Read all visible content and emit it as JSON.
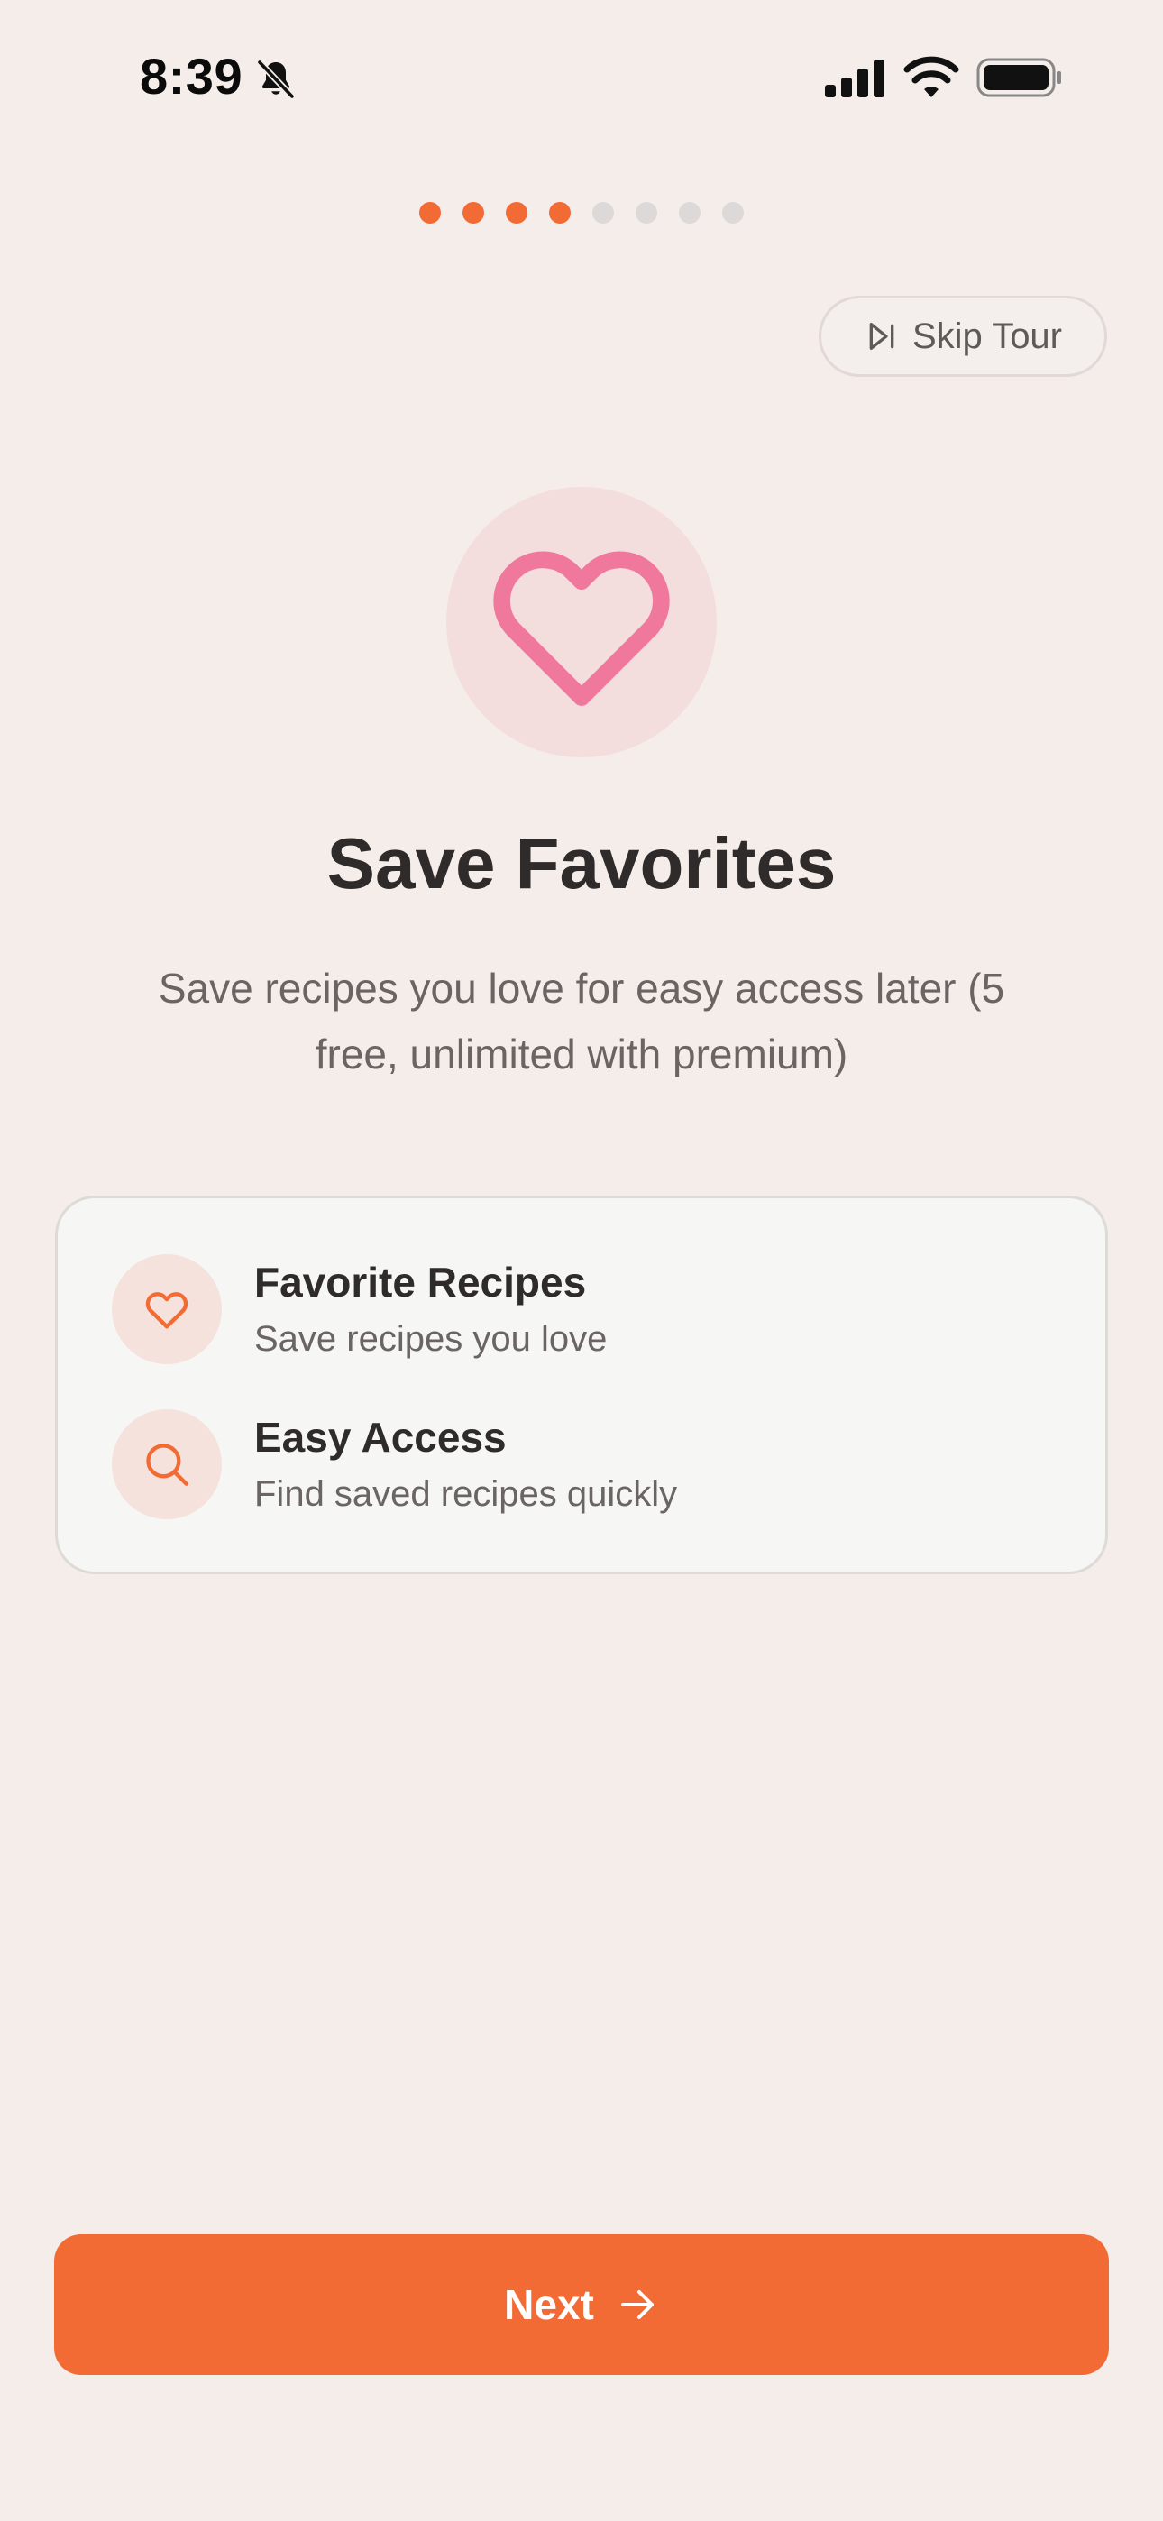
{
  "status_bar": {
    "time": "8:39",
    "icons": [
      "bell-slash-icon",
      "cellular-signal-icon",
      "wifi-icon",
      "battery-icon"
    ]
  },
  "onboarding": {
    "total_steps": 8,
    "current_step": 4
  },
  "skip_tour": {
    "label": "Skip Tour",
    "icon": "skip-forward-icon"
  },
  "hero": {
    "icon": "heart-icon",
    "icon_color": "#F0789C",
    "background": "#F4DEDD"
  },
  "title": "Save Favorites",
  "subtitle": "Save recipes you love for easy access later (5 free, unlimited with premium)",
  "features": [
    {
      "icon": "heart-icon",
      "title": "Favorite Recipes",
      "description": "Save recipes you love"
    },
    {
      "icon": "search-icon",
      "title": "Easy Access",
      "description": "Find saved recipes quickly"
    }
  ],
  "next_button": {
    "label": "Next",
    "icon": "arrow-right-icon"
  },
  "colors": {
    "accent": "#F26B35",
    "background": "#F5EDE9",
    "dot_inactive": "#DCD9D8"
  }
}
